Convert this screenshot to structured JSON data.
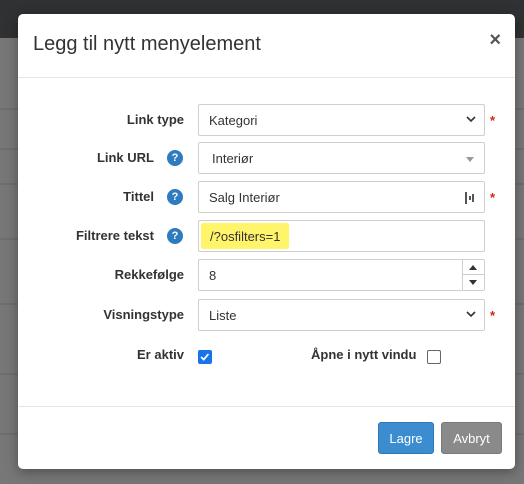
{
  "modal": {
    "title": "Legg til nytt menyelement",
    "close_label": "×"
  },
  "form": {
    "link_type": {
      "label": "Link type",
      "value": "Kategori",
      "required": "*"
    },
    "link_url": {
      "label": "Link URL",
      "value": "Interiør",
      "help": "?"
    },
    "tittel": {
      "label": "Tittel",
      "value": "Salg Interiør",
      "help": "?",
      "required": "*"
    },
    "filtrere_tekst": {
      "label": "Filtrere tekst",
      "value": "/?osfilters=1",
      "help": "?"
    },
    "rekkefolge": {
      "label": "Rekkefølge",
      "value": "8"
    },
    "visningstype": {
      "label": "Visningstype",
      "value": "Liste",
      "required": "*"
    },
    "er_aktiv": {
      "label": "Er aktiv",
      "checked": true
    },
    "apne_nytt_vindu": {
      "label": "Åpne i nytt vindu",
      "checked": false
    }
  },
  "footer": {
    "save_label": "Lagre",
    "cancel_label": "Avbryt"
  },
  "colors": {
    "primary": "#3c8dd0",
    "secondary": "#8a8a8a",
    "required": "#d9230f",
    "help": "#2e7bbf",
    "highlight": "#fff46a"
  }
}
